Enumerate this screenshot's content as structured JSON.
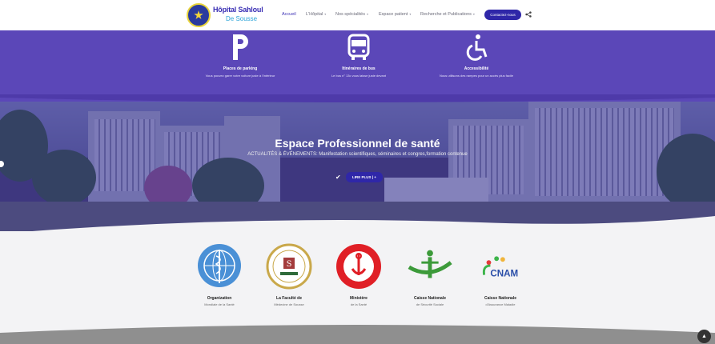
{
  "header": {
    "brand_line1": "Hôpital Sahloul",
    "brand_line2": "De Sousse",
    "nav": [
      {
        "label": "Accueil",
        "active": true,
        "dropdown": false
      },
      {
        "label": "L'Hôpital",
        "active": false,
        "dropdown": true
      },
      {
        "label": "Nos spécialités",
        "active": false,
        "dropdown": true
      },
      {
        "label": "Espace patient",
        "active": false,
        "dropdown": true
      },
      {
        "label": "Recherche et Publications",
        "active": false,
        "dropdown": true
      }
    ],
    "contact_label": "Contactez-nous"
  },
  "features": [
    {
      "icon": "parking-icon",
      "title": "Places de parking",
      "desc": "Vous pouvez garer votre voiture juste à l'intérieur"
    },
    {
      "icon": "bus-icon",
      "title": "Itinéraires de bus",
      "desc": "Le bus n° 13c vous laisse juste devant"
    },
    {
      "icon": "wheelchair-icon",
      "title": "Accessibilité",
      "desc": "Nous utilisons des rampes pour un accès plus facile"
    }
  ],
  "hero": {
    "title": "Espace Professionnel de santé",
    "subtitle": "ACTUALITÉS & ÉVÉNEMENTS: Manifestation scientifiques, séminaires et congres,formation contenue",
    "button": "LIRE PLUS | +"
  },
  "partners": [
    {
      "name": "Organization",
      "sub": "Mondiale de la Santé",
      "logo": "who-logo"
    },
    {
      "name": "La Faculté de",
      "sub": "Médecine de Sousse",
      "logo": "faculty-logo"
    },
    {
      "name": "Ministère",
      "sub": "de la Santé",
      "logo": "ministry-logo"
    },
    {
      "name": "Caisse Nationale",
      "sub": "de Sécurité Sociale",
      "logo": "cnss-logo"
    },
    {
      "name": "Caisse Nationale",
      "sub": "d'Assurance Maladie",
      "logo": "cnam-logo",
      "logo_text": "CNAM"
    }
  ],
  "colors": {
    "accent": "#3a2fb4",
    "band": "#5b47b8",
    "button": "#2f27a8"
  }
}
